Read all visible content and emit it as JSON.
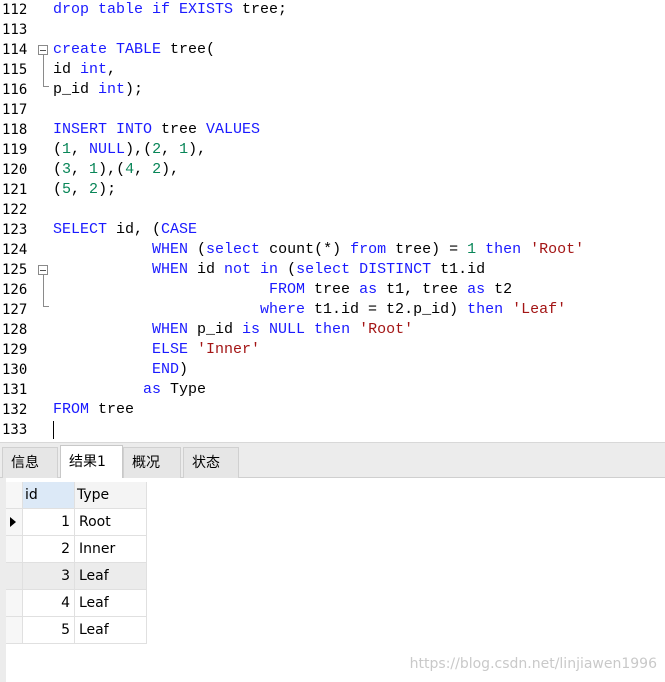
{
  "editor": {
    "lines": [
      {
        "no": "112",
        "tokens": [
          {
            "t": "drop table if EXISTS",
            "c": "kw"
          },
          {
            "t": " tree;",
            "c": "plain"
          }
        ]
      },
      {
        "no": "113",
        "tokens": []
      },
      {
        "no": "114",
        "tokens": [
          {
            "t": "create TABLE",
            "c": "kw"
          },
          {
            "t": " tree(",
            "c": "plain"
          }
        ]
      },
      {
        "no": "115",
        "tokens": [
          {
            "t": "id ",
            "c": "plain"
          },
          {
            "t": "int",
            "c": "kw"
          },
          {
            "t": ",",
            "c": "plain"
          }
        ]
      },
      {
        "no": "116",
        "tokens": [
          {
            "t": "p_id ",
            "c": "plain"
          },
          {
            "t": "int",
            "c": "kw"
          },
          {
            "t": ");",
            "c": "plain"
          }
        ]
      },
      {
        "no": "117",
        "tokens": []
      },
      {
        "no": "118",
        "tokens": [
          {
            "t": "INSERT INTO",
            "c": "kw"
          },
          {
            "t": " tree ",
            "c": "plain"
          },
          {
            "t": "VALUES",
            "c": "kw"
          }
        ]
      },
      {
        "no": "119",
        "tokens": [
          {
            "t": "(",
            "c": "plain"
          },
          {
            "t": "1",
            "c": "num"
          },
          {
            "t": ", ",
            "c": "plain"
          },
          {
            "t": "NULL",
            "c": "kw"
          },
          {
            "t": "),(",
            "c": "plain"
          },
          {
            "t": "2",
            "c": "num"
          },
          {
            "t": ", ",
            "c": "plain"
          },
          {
            "t": "1",
            "c": "num"
          },
          {
            "t": "),",
            "c": "plain"
          }
        ]
      },
      {
        "no": "120",
        "tokens": [
          {
            "t": "(",
            "c": "plain"
          },
          {
            "t": "3",
            "c": "num"
          },
          {
            "t": ", ",
            "c": "plain"
          },
          {
            "t": "1",
            "c": "num"
          },
          {
            "t": "),(",
            "c": "plain"
          },
          {
            "t": "4",
            "c": "num"
          },
          {
            "t": ", ",
            "c": "plain"
          },
          {
            "t": "2",
            "c": "num"
          },
          {
            "t": "),",
            "c": "plain"
          }
        ]
      },
      {
        "no": "121",
        "tokens": [
          {
            "t": "(",
            "c": "plain"
          },
          {
            "t": "5",
            "c": "num"
          },
          {
            "t": ", ",
            "c": "plain"
          },
          {
            "t": "2",
            "c": "num"
          },
          {
            "t": ");",
            "c": "plain"
          }
        ]
      },
      {
        "no": "122",
        "tokens": []
      },
      {
        "no": "123",
        "tokens": [
          {
            "t": "SELECT",
            "c": "kw"
          },
          {
            "t": " id, (",
            "c": "plain"
          },
          {
            "t": "CASE",
            "c": "kw"
          }
        ]
      },
      {
        "no": "124",
        "tokens": [
          {
            "t": "           WHEN",
            "c": "kw"
          },
          {
            "t": " (",
            "c": "plain"
          },
          {
            "t": "select",
            "c": "kw"
          },
          {
            "t": " count(*) ",
            "c": "plain"
          },
          {
            "t": "from",
            "c": "kw"
          },
          {
            "t": " tree) = ",
            "c": "plain"
          },
          {
            "t": "1",
            "c": "num"
          },
          {
            "t": " ",
            "c": "plain"
          },
          {
            "t": "then",
            "c": "kw"
          },
          {
            "t": " ",
            "c": "plain"
          },
          {
            "t": "'Root'",
            "c": "str"
          }
        ]
      },
      {
        "no": "125",
        "tokens": [
          {
            "t": "           WHEN",
            "c": "kw"
          },
          {
            "t": " id ",
            "c": "plain"
          },
          {
            "t": "not in",
            "c": "kw"
          },
          {
            "t": " (",
            "c": "plain"
          },
          {
            "t": "select DISTINCT",
            "c": "kw"
          },
          {
            "t": " t1.id",
            "c": "plain"
          }
        ]
      },
      {
        "no": "126",
        "tokens": [
          {
            "t": "                        FROM",
            "c": "kw"
          },
          {
            "t": " tree ",
            "c": "plain"
          },
          {
            "t": "as",
            "c": "kw"
          },
          {
            "t": " t1, tree ",
            "c": "plain"
          },
          {
            "t": "as",
            "c": "kw"
          },
          {
            "t": " t2",
            "c": "plain"
          }
        ]
      },
      {
        "no": "127",
        "tokens": [
          {
            "t": "                       where",
            "c": "kw"
          },
          {
            "t": " t1.id = t2.p_id) ",
            "c": "plain"
          },
          {
            "t": "then",
            "c": "kw"
          },
          {
            "t": " ",
            "c": "plain"
          },
          {
            "t": "'Leaf'",
            "c": "str"
          }
        ]
      },
      {
        "no": "128",
        "tokens": [
          {
            "t": "           WHEN",
            "c": "kw"
          },
          {
            "t": " p_id ",
            "c": "plain"
          },
          {
            "t": "is NULL then",
            "c": "kw"
          },
          {
            "t": " ",
            "c": "plain"
          },
          {
            "t": "'Root'",
            "c": "str"
          }
        ]
      },
      {
        "no": "129",
        "tokens": [
          {
            "t": "           ELSE",
            "c": "kw"
          },
          {
            "t": " ",
            "c": "plain"
          },
          {
            "t": "'Inner'",
            "c": "str"
          }
        ]
      },
      {
        "no": "130",
        "tokens": [
          {
            "t": "           END",
            "c": "kw"
          },
          {
            "t": ")",
            "c": "plain"
          }
        ]
      },
      {
        "no": "131",
        "tokens": [
          {
            "t": "          as",
            "c": "kw"
          },
          {
            "t": " Type",
            "c": "plain"
          }
        ]
      },
      {
        "no": "132",
        "tokens": [
          {
            "t": "FROM",
            "c": "kw"
          },
          {
            "t": " tree",
            "c": "plain"
          }
        ]
      },
      {
        "no": "133",
        "tokens": []
      }
    ],
    "colors": {
      "keyword": "#1a1aff",
      "string": "#a31515",
      "number": "#098658"
    }
  },
  "tabs": [
    {
      "label": "信息",
      "active": false
    },
    {
      "label": "结果1",
      "active": true
    },
    {
      "label": "概况",
      "active": false
    },
    {
      "label": "状态",
      "active": false
    }
  ],
  "grid": {
    "columns": [
      "id",
      "Type"
    ],
    "rows": [
      {
        "id": "1",
        "type": "Root",
        "current": true
      },
      {
        "id": "2",
        "type": "Inner",
        "current": false
      },
      {
        "id": "3",
        "type": "Leaf",
        "current": false
      },
      {
        "id": "4",
        "type": "Leaf",
        "current": false
      },
      {
        "id": "5",
        "type": "Leaf",
        "current": false
      }
    ]
  },
  "watermark": "https://blog.csdn.net/linjiawen1996"
}
